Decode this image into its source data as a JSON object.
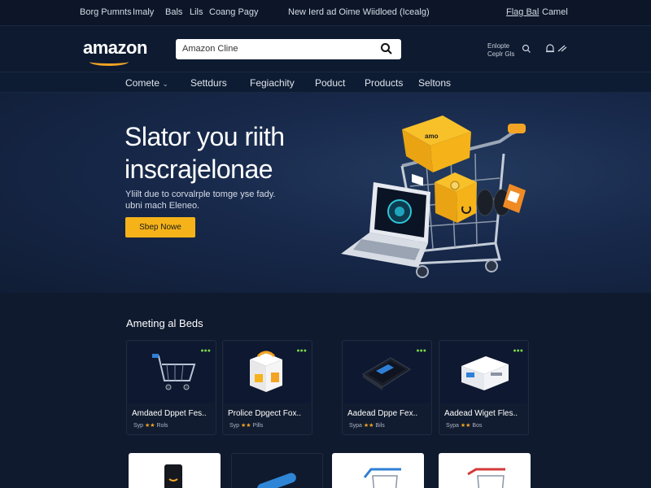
{
  "topbar": {
    "links": [
      "Borg Pumnts",
      "Imaly",
      "Bals",
      "Lils",
      "Coang Pagy"
    ],
    "promo": "New Ierd ad Oime Wiidloed (Icealg)",
    "right_links": [
      "Flag Bal",
      "Camel"
    ]
  },
  "header": {
    "logo": "amazon",
    "search_placeholder": "Amazon Cline",
    "account_line1": "Enlopte",
    "account_line2": "Ceplr Gls"
  },
  "nav": {
    "items": [
      "Comete",
      "Settdurs",
      "Fegiachity",
      "Poduct",
      "Products",
      "Seltons"
    ]
  },
  "hero": {
    "title_line1": "Slator you riith",
    "title_line2": "inscrajelonae",
    "subtitle_line1": "Yliilt due to corvalrple tomge yse fady.",
    "subtitle_line2": "ubni mach Eleneo.",
    "cta": "Sbep Nowe",
    "box_label": "amo"
  },
  "deals": {
    "title": "Ameting al Beds",
    "cards": [
      {
        "name": "Amdaed Dppet Fes..",
        "price": "Syp ★★ Rols",
        "badge": "●●●"
      },
      {
        "name": "Prolice Dpgect Fox..",
        "price": "Syp ★★ Pills",
        "badge": "●●●"
      },
      {
        "name": "Aadead Dppe Fex..",
        "price": "Sypa ★★ Bils",
        "badge": "●●●"
      },
      {
        "name": "Aadead Wiget Fles..",
        "price": "Sypa ★★ Bos",
        "badge": "●●●"
      }
    ]
  },
  "colors": {
    "accent": "#f5b319",
    "brand_orange": "#f3a425",
    "bg": "#0f1a2e"
  }
}
